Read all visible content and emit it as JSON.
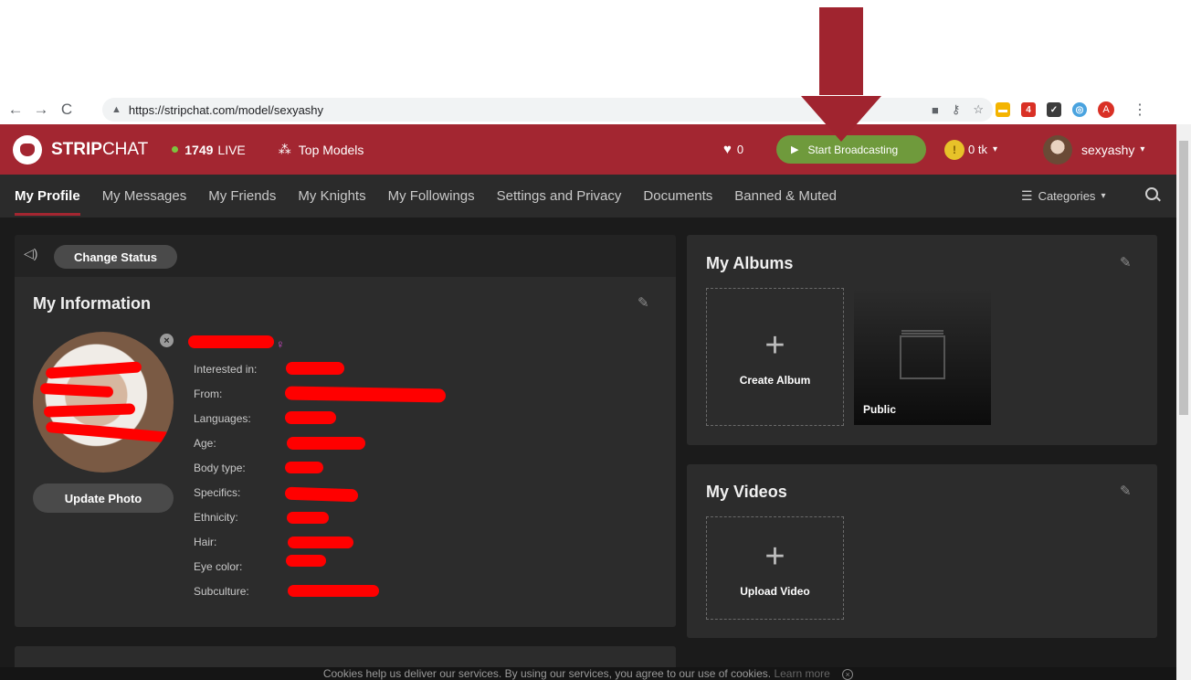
{
  "browser": {
    "url": "https://stripchat.com/model/sexyashy",
    "back": "←",
    "forward": "→",
    "reload": "C",
    "lock": "🔒",
    "profile_letter": "A",
    "ext_badge": "4"
  },
  "header": {
    "logo_bold": "STRIP",
    "logo_rest": "CHAT",
    "live_count": "1749",
    "live_label": "LIVE",
    "top_models": "Top Models",
    "likes": "0",
    "broadcast_label": "Start Broadcasting",
    "tokens": "0 tk",
    "username": "sexyashy",
    "caret": "▾"
  },
  "nav": {
    "tabs": [
      "My Profile",
      "My Messages",
      "My Friends",
      "My Knights",
      "My Followings",
      "Settings and Privacy",
      "Documents",
      "Banned & Muted"
    ],
    "categories": "Categories"
  },
  "status": {
    "change_status": "Change Status"
  },
  "info": {
    "title": "My Information",
    "update_photo": "Update Photo",
    "gender_symbol": "♀",
    "fields": [
      "Interested in:",
      "From:",
      "Languages:",
      "Age:",
      "Body type:",
      "Specifics:",
      "Ethnicity:",
      "Hair:",
      "Eye color:",
      "Subculture:"
    ]
  },
  "albums": {
    "title": "My Albums",
    "create_label": "Create Album",
    "public_label": "Public"
  },
  "videos": {
    "title": "My Videos",
    "upload_label": "Upload Video"
  },
  "cookie": {
    "text": "Cookies help us deliver our services. By using our services, you agree to our use of cookies.",
    "learn_more": "Learn more"
  },
  "colors": {
    "brand_red": "#a32631",
    "broadcast_green": "#6f9a3c",
    "annotation_arrow": "#a0242f",
    "redaction": "#ff0000"
  }
}
